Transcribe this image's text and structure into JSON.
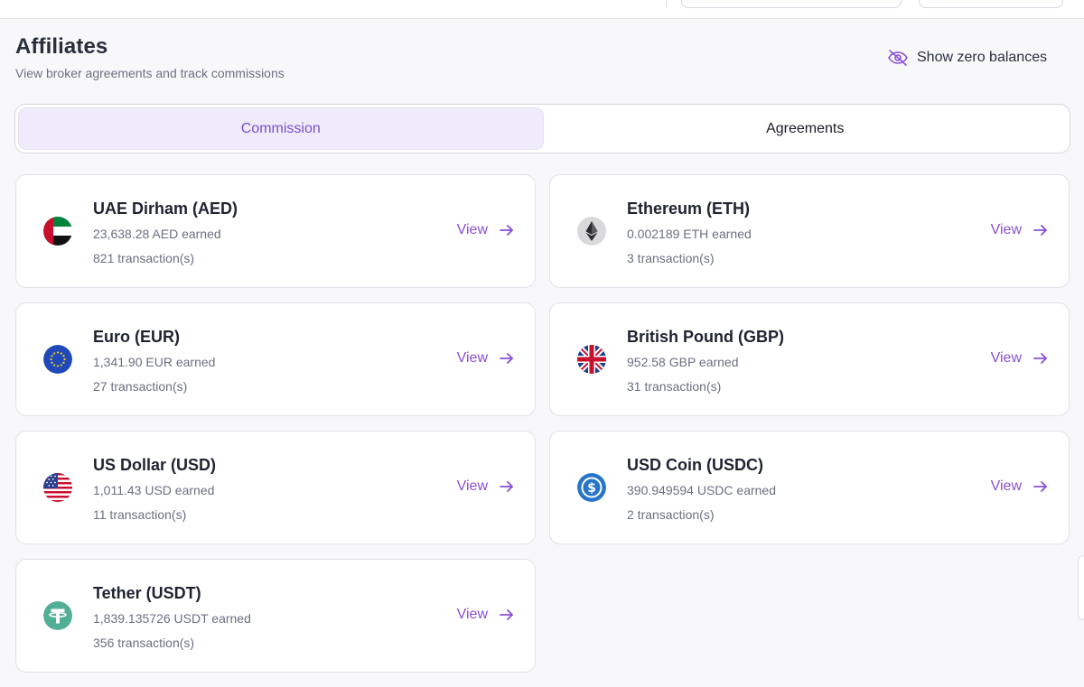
{
  "header": {
    "title": "Affiliates",
    "subtitle": "View broker agreements and track commissions",
    "zero_balances_label": "Show zero balances",
    "zero_balances_icon": "eye-off-icon"
  },
  "tabs": [
    {
      "label": "Commission",
      "active": true
    },
    {
      "label": "Agreements",
      "active": false
    }
  ],
  "colors": {
    "accent": "#8a4fd6",
    "active_tab_bg": "#efebfb"
  },
  "currencies": [
    {
      "name": "UAE Dirham (AED)",
      "earned": "23,638.28 AED earned",
      "transactions": "821 transaction(s)",
      "icon": "aed-flag-icon",
      "view_label": "View"
    },
    {
      "name": "Ethereum (ETH)",
      "earned": "0.002189 ETH earned",
      "transactions": "3 transaction(s)",
      "icon": "ethereum-icon",
      "view_label": "View"
    },
    {
      "name": "Euro (EUR)",
      "earned": "1,341.90 EUR earned",
      "transactions": "27 transaction(s)",
      "icon": "eu-flag-icon",
      "view_label": "View"
    },
    {
      "name": "British Pound (GBP)",
      "earned": "952.58 GBP earned",
      "transactions": "31 transaction(s)",
      "icon": "uk-flag-icon",
      "view_label": "View"
    },
    {
      "name": "US Dollar (USD)",
      "earned": "1,011.43 USD earned",
      "transactions": "11 transaction(s)",
      "icon": "us-flag-icon",
      "view_label": "View"
    },
    {
      "name": "USD Coin (USDC)",
      "earned": "390.949594 USDC earned",
      "transactions": "2 transaction(s)",
      "icon": "usdc-icon",
      "view_label": "View"
    },
    {
      "name": "Tether (USDT)",
      "earned": "1,839.135726 USDT earned",
      "transactions": "356 transaction(s)",
      "icon": "tether-icon",
      "view_label": "View"
    }
  ]
}
